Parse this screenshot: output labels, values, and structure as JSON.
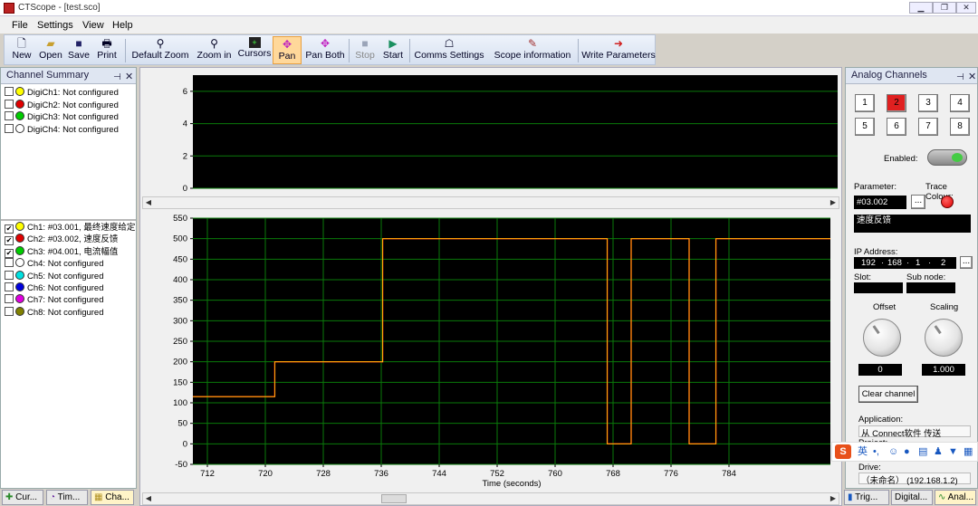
{
  "window": {
    "app": "CTScope",
    "title": "CTScope - [test.sco]"
  },
  "menu": [
    "File",
    "Settings",
    "View",
    "Help"
  ],
  "toolbar": {
    "new": "New",
    "open": "Open",
    "save": "Save",
    "print": "Print",
    "default_zoom": "Default Zoom",
    "zoom_in": "Zoom in",
    "cursors": "Cursors",
    "pan": "Pan",
    "pan_both": "Pan Both",
    "stop": "Stop",
    "start": "Start",
    "comms_settings": "Comms Settings",
    "scope_information": "Scope information",
    "write_parameters": "Write Parameters"
  },
  "channel_summary": {
    "title": "Channel Summary",
    "digital": [
      {
        "label": "DigiCh1: Not configured",
        "color": "#ffff00",
        "checked": false
      },
      {
        "label": "DigiCh2: Not configured",
        "color": "#e00000",
        "checked": false
      },
      {
        "label": "DigiCh3: Not configured",
        "color": "#00cc00",
        "checked": false
      },
      {
        "label": "DigiCh4: Not configured",
        "color": "#ffffff",
        "checked": false
      }
    ],
    "analog": [
      {
        "label": "Ch1: #03.001, 最终速度给定",
        "color": "#ffff00",
        "checked": true
      },
      {
        "label": "Ch2: #03.002, 速度反馈",
        "color": "#e00000",
        "checked": true
      },
      {
        "label": "Ch3: #04.001, 电流幅值",
        "color": "#00cc00",
        "checked": true
      },
      {
        "label": "Ch4: Not configured",
        "color": "#ffffff",
        "checked": false
      },
      {
        "label": "Ch5: Not configured",
        "color": "#00e0e0",
        "checked": false
      },
      {
        "label": "Ch6: Not configured",
        "color": "#0000dd",
        "checked": false
      },
      {
        "label": "Ch7: Not configured",
        "color": "#e000e0",
        "checked": false
      },
      {
        "label": "Ch8: Not configured",
        "color": "#808000",
        "checked": false
      }
    ]
  },
  "bottom_tabs_left": [
    "Cur...",
    "Tim...",
    "Cha..."
  ],
  "bottom_tabs_right": [
    "Trig...",
    "Digital...",
    "Anal..."
  ],
  "chart_data": [
    {
      "type": "line",
      "name": "digital",
      "ylim": [
        0,
        7
      ],
      "yticks": [
        0,
        2,
        4,
        6
      ],
      "series": []
    },
    {
      "type": "line",
      "name": "analog",
      "xlabel": "Time (seconds)",
      "xlim": [
        710,
        798
      ],
      "ylim": [
        -50,
        550
      ],
      "xticks": [
        712,
        720,
        728,
        736,
        744,
        752,
        760,
        768,
        776,
        784
      ],
      "yticks": [
        -50,
        0,
        50,
        100,
        150,
        200,
        250,
        300,
        350,
        400,
        450,
        500,
        550
      ],
      "grid": true,
      "series": [
        {
          "color": "#ff2020",
          "x": [
            710,
            721.3,
            721.3,
            736.2,
            736.2,
            767.2,
            767.2,
            770.5,
            770.5,
            778.5,
            778.5,
            782.2,
            782.2,
            798
          ],
          "y": [
            115,
            115,
            200,
            200,
            500,
            500,
            0,
            0,
            500,
            500,
            0,
            0,
            500,
            500
          ]
        },
        {
          "color": "#ffcc00",
          "x": [
            710,
            721.3,
            721.3,
            736.2,
            736.2,
            767.2,
            767.2,
            770.5,
            770.5,
            778.5,
            778.5,
            782.2,
            782.2,
            798
          ],
          "y": [
            115,
            115,
            200,
            200,
            500,
            500,
            0,
            0,
            500,
            500,
            0,
            0,
            500,
            500
          ]
        }
      ]
    }
  ],
  "analog_panel": {
    "title": "Analog Channels",
    "channels": [
      "1",
      "2",
      "3",
      "4",
      "5",
      "6",
      "7",
      "8"
    ],
    "selected": "2",
    "enabled_label": "Enabled:",
    "parameter_label": "Parameter:",
    "trace_colour_label": "Trace Colour:",
    "parameter_value": "#03.002",
    "browse": "...",
    "description": "速度反馈",
    "ip_label": "IP Address:",
    "ip": [
      "192",
      "168",
      "1",
      "2"
    ],
    "slot_label": "Slot:",
    "subnode_label": "Sub node:",
    "offset_label": "Offset",
    "scaling_label": "Scaling",
    "offset_value": "0",
    "scaling_value": "1.000",
    "clear_channel": "Clear channel",
    "application_label": "Application:",
    "application_value": "从 Connect软件 传送",
    "project_label": "Project:",
    "drive_label": "Drive:",
    "drive_value": "（未命名） (192.168.1.2)",
    "trace_color": "#e00000"
  },
  "ime_bar": {
    "label": "英"
  }
}
